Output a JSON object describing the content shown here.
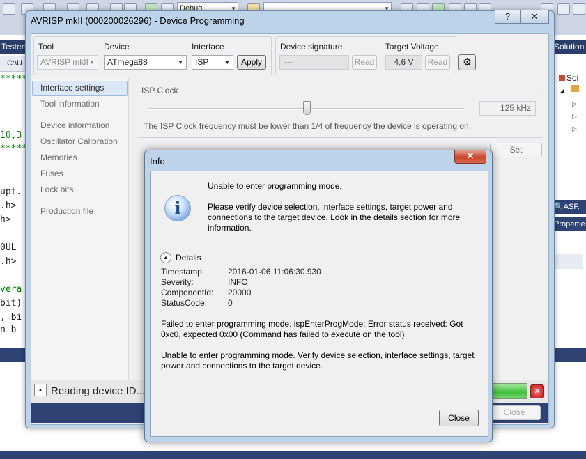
{
  "ide": {
    "config_combo": "Debug",
    "left_tab": "Tester*",
    "left_path": "C:\\U",
    "solution_tab": "Solution",
    "solution_item": "Sol",
    "asf_label": "ASF.",
    "properties_label": "Propertie",
    "code_lines": [
      {
        "text": "*****",
        "color": "#008000"
      },
      {
        "text": "10,3",
        "color": "#008000"
      },
      {
        "text": "*****",
        "color": "#008000"
      },
      {
        "text": "upt.",
        "color": "#1e1e1e"
      },
      {
        "text": ".h>",
        "color": "#1e1e1e"
      },
      {
        "text": "h>",
        "color": "#1e1e1e"
      },
      {
        "text": "0UL",
        "color": "#1e1e1e"
      },
      {
        "text": ".h>",
        "color": "#1e1e1e"
      },
      {
        "text": "vera",
        "color": "#008000"
      },
      {
        "text": "bit)",
        "color": "#1e1e1e"
      },
      {
        "text": ", bi",
        "color": "#1e1e1e"
      },
      {
        "text": "n b",
        "color": "#1e1e1e"
      }
    ]
  },
  "device_programming": {
    "title": "AVRISP mkII (000200026296) - Device Programming",
    "help_button": "?",
    "close_button": "✕",
    "tool_label": "Tool",
    "tool_value": "AVRISP mkII",
    "device_label": "Device",
    "device_value": "ATmega88",
    "interface_label": "Interface",
    "interface_value": "ISP",
    "apply_button": "Apply",
    "signature_label": "Device signature",
    "signature_value": "---",
    "signature_read": "Read",
    "voltage_label": "Target Voltage",
    "voltage_value": "4,6 V",
    "voltage_read": "Read",
    "nav_items": [
      {
        "label": "Interface settings",
        "selected": true
      },
      {
        "label": "Tool information"
      },
      {
        "label": "Device information"
      },
      {
        "label": "Oscillator Calibration"
      },
      {
        "label": "Memories"
      },
      {
        "label": "Fuses"
      },
      {
        "label": "Lock bits"
      },
      {
        "label": "Production file"
      }
    ],
    "isp_clock": {
      "legend": "ISP Clock",
      "value": "125 kHz",
      "slider_fraction": 0.5,
      "note": "The ISP Clock frequency must be lower than 1/4 of frequency the device is operating on.",
      "set_button": "Set"
    },
    "status_text": "Reading device ID...",
    "progress_fraction": 1.0,
    "close_bottom": "Close",
    "colors": {
      "selection": "#dce8f5",
      "progress": "#3fc23b",
      "error": "#c11d1d"
    }
  },
  "info_dialog": {
    "title": "Info",
    "close_x": "✕",
    "icon": "info-icon",
    "heading": "Unable to enter programming mode.",
    "message": "Please verify device selection, interface settings, target power and connections to the target device. Look in the details section for more information.",
    "details_label": "Details",
    "details": [
      {
        "key": "Timestamp:",
        "value": "2016-01-06 11:06:30.930"
      },
      {
        "key": "Severity:",
        "value": "INFO"
      },
      {
        "key": "ComponentId:",
        "value": "20000"
      },
      {
        "key": "StatusCode:",
        "value": "0"
      }
    ],
    "error_text": "Failed to enter programming mode. ispEnterProgMode: Error status received: Got 0xc0, expected 0x00 (Command has failed to execute on the tool)",
    "summary_text": "Unable to enter programming mode. Verify device selection, interface settings, target power and connections to the target device.",
    "close_button": "Close"
  }
}
